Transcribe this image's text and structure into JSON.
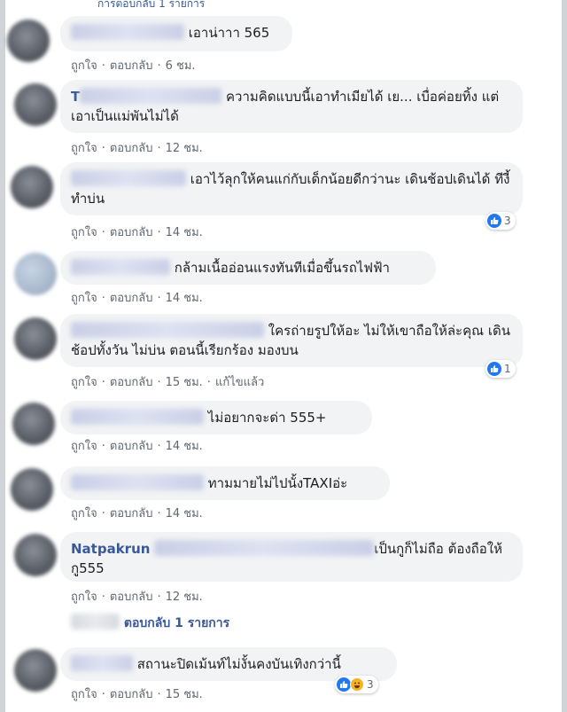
{
  "top_cut_text": "การตอบกลับ 1 รายการ",
  "actions": {
    "like": "ถูกใจ",
    "reply": "ตอบกลับ",
    "edited": "แก้ไขแล้ว"
  },
  "comments": [
    {
      "name": "",
      "text": "เอาน่าาา 565",
      "time": "6 ชม."
    },
    {
      "name": "T",
      "text": "ความคิดแบบนี้เอาทำเมียได้ เย... เบื่อค่อยทิ้ง แต่เอาเป็นแม่พันไม่ได้",
      "time": "12 ชม."
    },
    {
      "name": "",
      "text": "เอาไว้ลุกให้คนแก่กับเด็กน้อยดีกว่านะ เดินช้อปเดินได้ ทีงี้ทำบ่น",
      "time": "14 ชม.",
      "reactions": "3"
    },
    {
      "name": "",
      "text": "กล้ามเนื้ออ่อนแรงทันทีเมื่อขึ้นรถไฟฟ้า",
      "time": "14 ชม."
    },
    {
      "name": "",
      "text": "ใครถ่ายรูปให้อะ ไม่ให้เขาถือให้ล่ะคุณ เดินช้อปทั้งวัน ไม่บ่น ตอนนี้เรียกร้อง มองบน",
      "time": "15 ชม.",
      "reactions": "1"
    },
    {
      "name": "",
      "text": "ไม่อยากจะด่า 555+",
      "time": "14 ชม."
    },
    {
      "name": "",
      "text": "ทามมายไม่ไปนั้งTAXIอ่ะ",
      "time": "14 ชม."
    },
    {
      "name": "Natpakrun",
      "text": "เป็นกูก็ไม่ถือ ต้องถือให้กู555",
      "time": "12 ชม."
    },
    {
      "name": "",
      "text": "สถานะปิดเม้นท์ไม่งั้นคงบันเทิงกว่านี้",
      "time": "15 ชม.",
      "reactions": "3"
    }
  ],
  "reply_summary": "ตอบกลับ 1 รายการ",
  "colors": {
    "link": "#385898",
    "bubble": "#f2f3f5",
    "like": "#2078f4",
    "haha": "#f7b125"
  }
}
